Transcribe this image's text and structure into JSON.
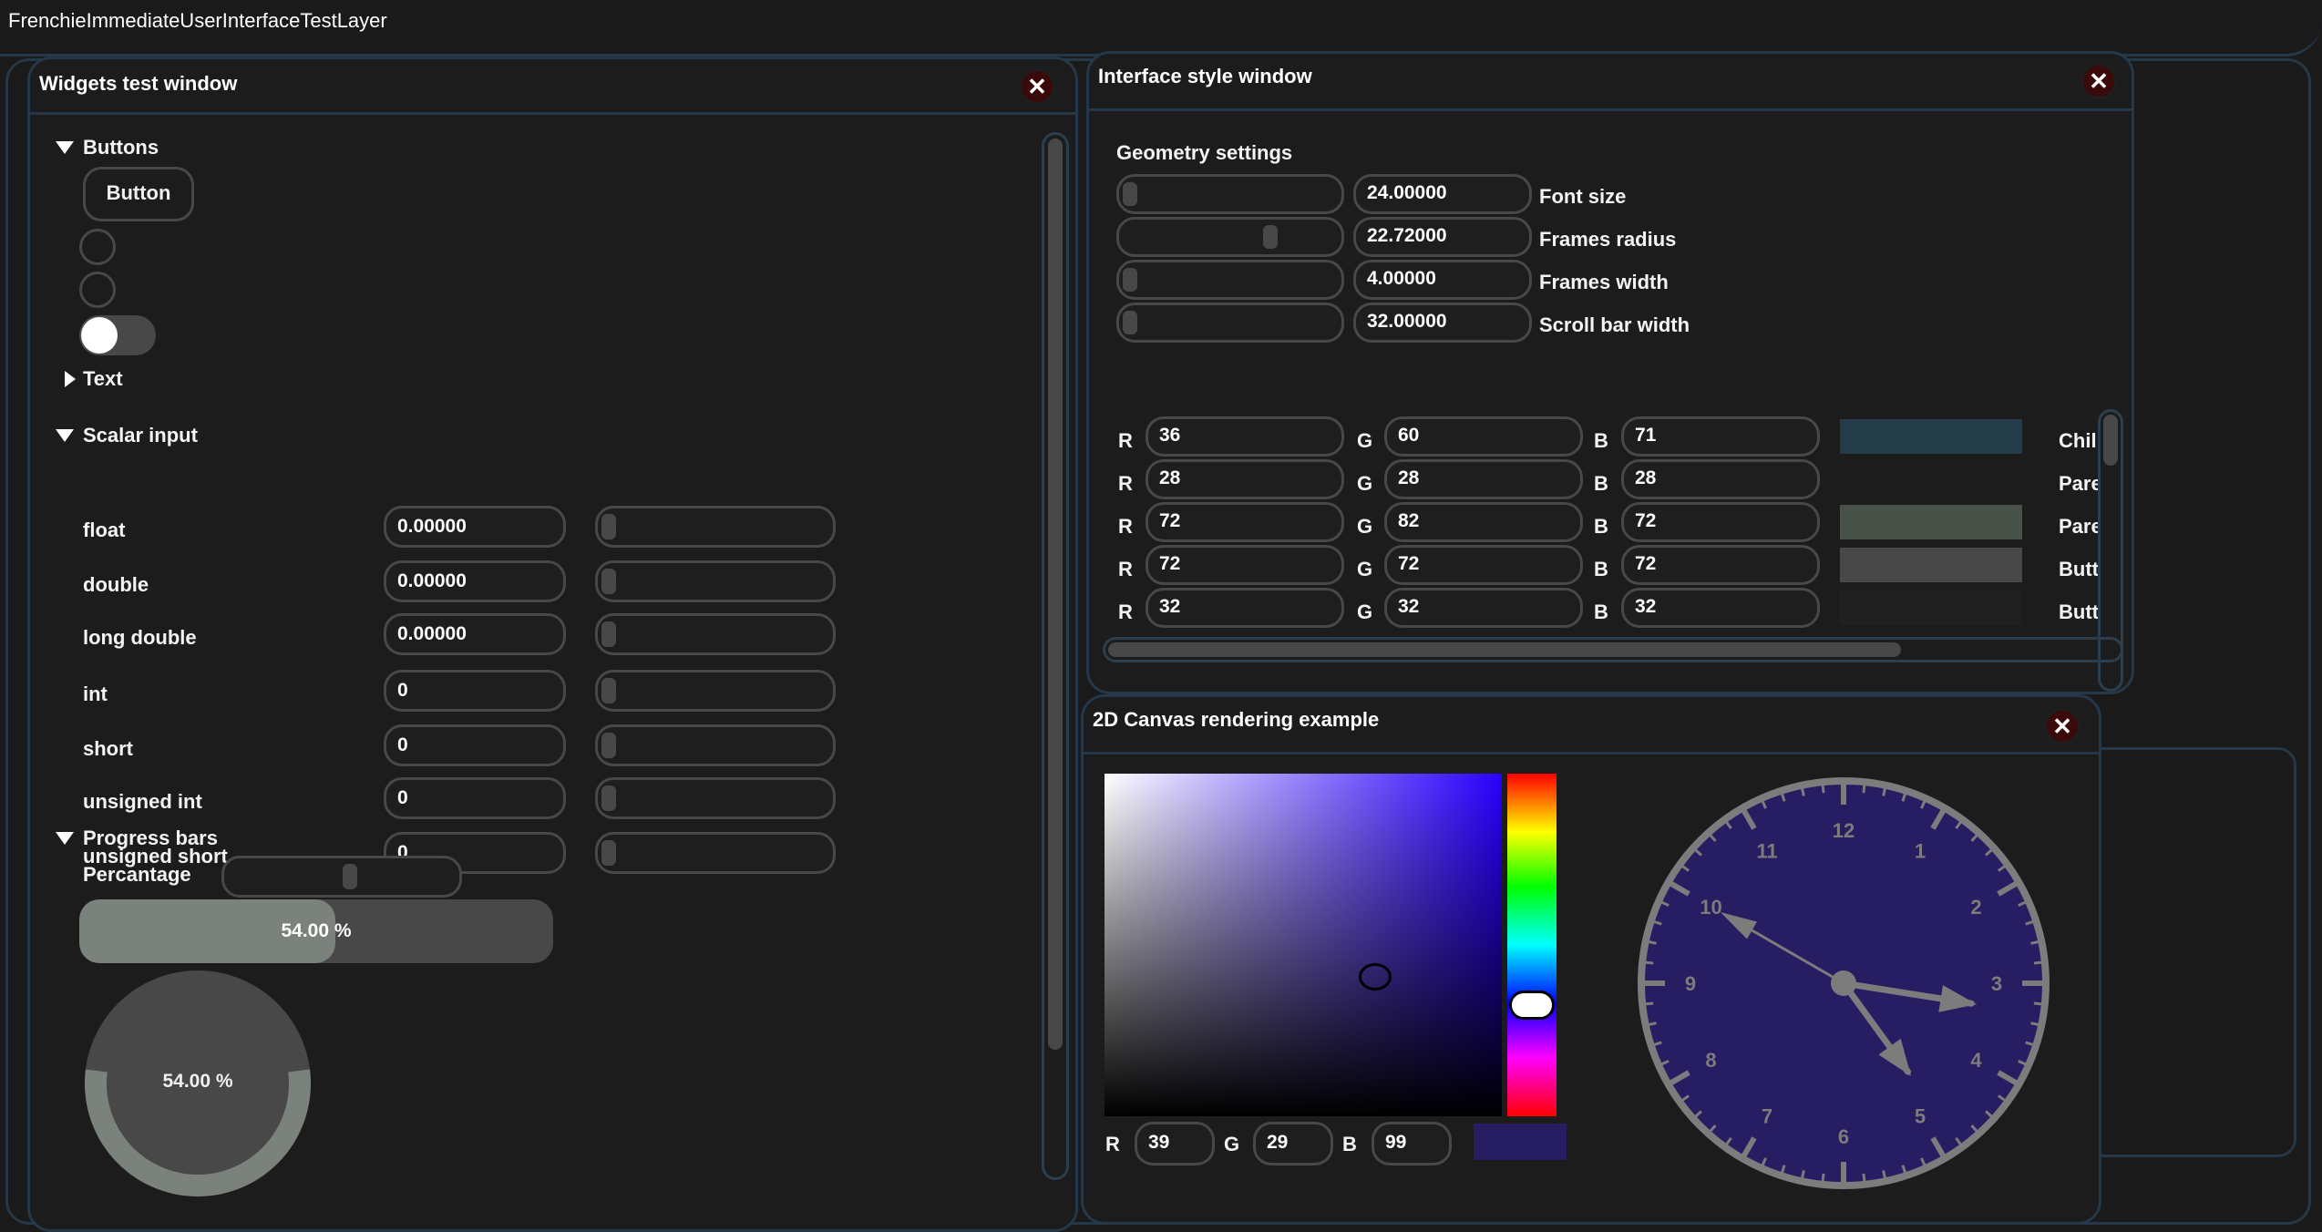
{
  "app_title": "FrenchieImmediateUserInterfaceTestLayer",
  "widgets": {
    "title": "Widgets test window",
    "close": "✕",
    "buttons_header": "Buttons",
    "button_label": "Button",
    "toggle_on": true,
    "text_header": "Text",
    "scalar_header": "Scalar input",
    "scalar_rows": [
      {
        "label": "float",
        "value": "0.00000"
      },
      {
        "label": "double",
        "value": "0.00000"
      },
      {
        "label": "long double",
        "value": "0.00000"
      },
      {
        "label": "int",
        "value": "0"
      },
      {
        "label": "short",
        "value": "0"
      },
      {
        "label": "unsigned int",
        "value": "0"
      },
      {
        "label": "unsigned short",
        "value": "0"
      }
    ],
    "progress_header": "Progress bars",
    "percentage_label": "Percantage",
    "percentage_fraction": 0.54,
    "bar_text": "54.00 %",
    "circle_text": "54.00 %"
  },
  "style": {
    "title": "Interface style window",
    "close": "✕",
    "geometry_header": "Geometry settings",
    "geometry": [
      {
        "label": "Font size",
        "value": "24.00000",
        "level": 0.0
      },
      {
        "label": "Frames radius",
        "value": "22.72000",
        "level": 0.7
      },
      {
        "label": "Frames width",
        "value": "4.00000",
        "level": 0.0
      },
      {
        "label": "Scroll bar width",
        "value": "32.00000",
        "level": 0.0
      }
    ],
    "color_rows": [
      {
        "r": "36",
        "g": "60",
        "b": "71",
        "swatch": "#243c47",
        "name": "Chil"
      },
      {
        "r": "28",
        "g": "28",
        "b": "28",
        "swatch": "#1c1c1c",
        "name": "Pare"
      },
      {
        "r": "72",
        "g": "82",
        "b": "72",
        "swatch": "#485248",
        "name": "Pare"
      },
      {
        "r": "72",
        "g": "72",
        "b": "72",
        "swatch": "#484848",
        "name": "Butt"
      },
      {
        "r": "32",
        "g": "32",
        "b": "32",
        "swatch": "#202020",
        "name": "Butt"
      }
    ],
    "r_label": "R",
    "g_label": "G",
    "b_label": "B"
  },
  "canvas": {
    "title": "2D Canvas rendering example",
    "close": "✕",
    "picker": {
      "r": "39",
      "g": "29",
      "b": "99",
      "color": "#271d63",
      "hue_base": "#2a00ff"
    },
    "r_label": "R",
    "g_label": "G",
    "b_label": "B",
    "clock": {
      "face_color": "#271d63",
      "numbers": [
        "12",
        "1",
        "2",
        "3",
        "4",
        "5",
        "6",
        "7",
        "8",
        "9",
        "10",
        "11"
      ],
      "hour": 4.8,
      "minute": 16.5,
      "second": 50
    }
  }
}
